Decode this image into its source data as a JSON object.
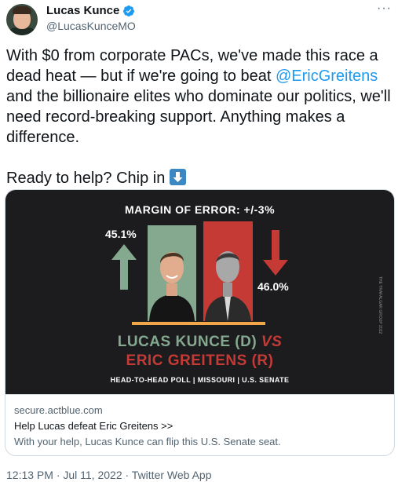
{
  "author": {
    "display_name": "Lucas Kunce",
    "handle": "@LucasKunceMO",
    "verified_color": "#1d9bf0"
  },
  "menu": {
    "more_label": "···"
  },
  "tweet": {
    "text_before_mention": "With $0 from corporate PACs, we've made this race a dead heat — but if we're going to beat ",
    "mention": "@EricGreitens",
    "text_after_mention": " and the billionaire elites who dominate our politics, we'll need record-breaking support. Anything makes a difference.",
    "cta_text": "Ready to help? Chip in ",
    "cta_emoji": "down-arrow-emoji"
  },
  "card": {
    "graphic": {
      "margin_of_error": "MARGIN OF ERROR: +/-3%",
      "kunce_pct": "45.1%",
      "greitens_pct": "46.0%",
      "name_line_kunce": "LUCAS KUNCE (D)",
      "name_line_vs": " VS",
      "name_line_greitens": "ERIC GREITENS (R)",
      "subtitle": "HEAD-TO-HEAD POLL | MISSOURI | U.S. SENATE",
      "credit": "THE TRAFALGAR GROUP 2022",
      "kunce_color": "#84a98f",
      "greitens_color": "#c53a35",
      "background": "#1c1c1f"
    },
    "domain": "secure.actblue.com",
    "title": "Help Lucas defeat Eric Greitens >>",
    "description": "With your help, Lucas Kunce can flip this U.S. Senate seat."
  },
  "footer": {
    "timestamp": "12:13 PM · Jul 11, 2022 · Twitter Web App"
  },
  "colors": {
    "text": "#0f1419",
    "secondary_text": "#536471",
    "link": "#1d9bf0",
    "border": "#cfd9de"
  }
}
